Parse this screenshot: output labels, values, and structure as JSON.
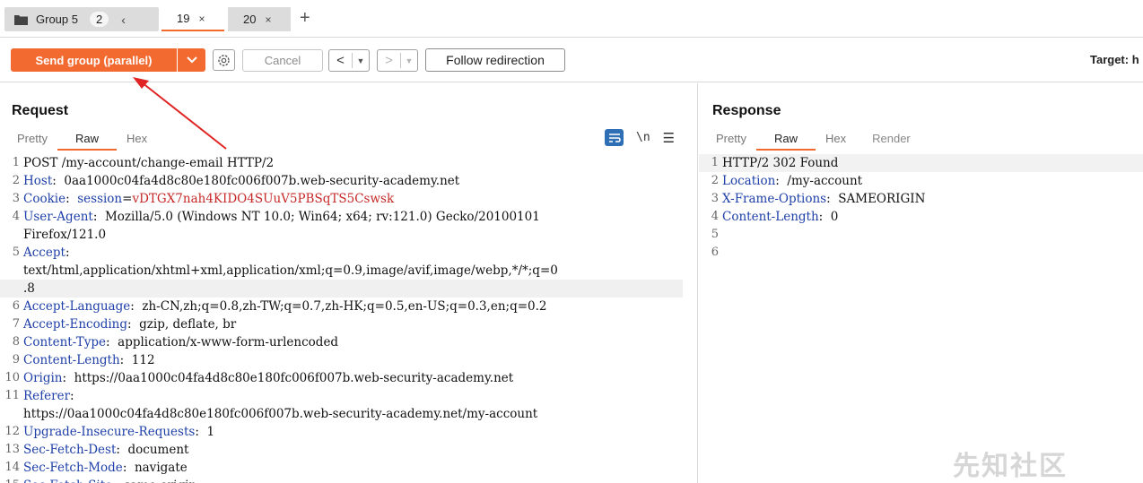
{
  "tabbar": {
    "group_label": "Group 5",
    "group_count": "2",
    "group_collapse": "‹",
    "tabs": [
      {
        "label": "19",
        "close": "×",
        "active": true
      },
      {
        "label": "20",
        "close": "×",
        "active": false
      }
    ],
    "add": "+"
  },
  "toolbar": {
    "send_label": "Send group (parallel)",
    "cancel_label": "Cancel",
    "back_arrow": "<",
    "forward_arrow": ">",
    "follow_label": "Follow redirection",
    "target_label": "Target: h"
  },
  "request": {
    "title": "Request",
    "tabs": [
      "Pretty",
      "Raw",
      "Hex"
    ],
    "active_tab": "Raw",
    "newline_icon": "\\n",
    "lines": [
      {
        "n": "1",
        "parts": [
          {
            "t": "POST /my-account/change-email HTTP/2",
            "c": "plain"
          }
        ]
      },
      {
        "n": "2",
        "parts": [
          {
            "t": "Host",
            "c": "name"
          },
          {
            "t": ":  0aa1000c04fa4d8c80e180fc006f007b.web-security-academy.net",
            "c": "plain"
          }
        ]
      },
      {
        "n": "3",
        "parts": [
          {
            "t": "Cookie",
            "c": "name"
          },
          {
            "t": ":  ",
            "c": "plain"
          },
          {
            "t": "session",
            "c": "name"
          },
          {
            "t": "=",
            "c": "plain"
          },
          {
            "t": "vDTGX7nah4KIDO4SUuV5PBSqTS5Cswsk",
            "c": "cookie"
          }
        ]
      },
      {
        "n": "4",
        "parts": [
          {
            "t": "User-Agent",
            "c": "name"
          },
          {
            "t": ":  Mozilla/5.0 (Windows NT 10.0; Win64; x64; rv:121.0) Gecko/20100101",
            "c": "plain"
          }
        ]
      },
      {
        "n": "",
        "parts": [
          {
            "t": "Firefox/121.0",
            "c": "plain"
          }
        ]
      },
      {
        "n": "5",
        "parts": [
          {
            "t": "Accept",
            "c": "name"
          },
          {
            "t": ":",
            "c": "plain"
          }
        ]
      },
      {
        "n": "",
        "parts": [
          {
            "t": "text/html,application/xhtml+xml,application/xml;q=0.9,image/avif,image/webp,*/*;q=0",
            "c": "plain"
          }
        ]
      },
      {
        "n": "",
        "hl": true,
        "parts": [
          {
            "t": ".8",
            "c": "plain"
          }
        ]
      },
      {
        "n": "6",
        "parts": [
          {
            "t": "Accept-Language",
            "c": "name"
          },
          {
            "t": ":  zh-CN,zh;q=0.8,zh-TW;q=0.7,zh-HK;q=0.5,en-US;q=0.3,en;q=0.2",
            "c": "plain"
          }
        ]
      },
      {
        "n": "7",
        "parts": [
          {
            "t": "Accept-Encoding",
            "c": "name"
          },
          {
            "t": ":  gzip, deflate, br",
            "c": "plain"
          }
        ]
      },
      {
        "n": "8",
        "parts": [
          {
            "t": "Content-Type",
            "c": "name"
          },
          {
            "t": ":  application/x-www-form-urlencoded",
            "c": "plain"
          }
        ]
      },
      {
        "n": "9",
        "parts": [
          {
            "t": "Content-Length",
            "c": "name"
          },
          {
            "t": ":  112",
            "c": "plain"
          }
        ]
      },
      {
        "n": "10",
        "parts": [
          {
            "t": "Origin",
            "c": "name"
          },
          {
            "t": ":  https://0aa1000c04fa4d8c80e180fc006f007b.web-security-academy.net",
            "c": "plain"
          }
        ]
      },
      {
        "n": "11",
        "parts": [
          {
            "t": "Referer",
            "c": "name"
          },
          {
            "t": ":",
            "c": "plain"
          }
        ]
      },
      {
        "n": "",
        "parts": [
          {
            "t": "https://0aa1000c04fa4d8c80e180fc006f007b.web-security-academy.net/my-account",
            "c": "plain"
          }
        ]
      },
      {
        "n": "12",
        "parts": [
          {
            "t": "Upgrade-Insecure-Requests",
            "c": "name"
          },
          {
            "t": ":  1",
            "c": "plain"
          }
        ]
      },
      {
        "n": "13",
        "parts": [
          {
            "t": "Sec-Fetch-Dest",
            "c": "name"
          },
          {
            "t": ":  document",
            "c": "plain"
          }
        ]
      },
      {
        "n": "14",
        "parts": [
          {
            "t": "Sec-Fetch-Mode",
            "c": "name"
          },
          {
            "t": ":  navigate",
            "c": "plain"
          }
        ]
      },
      {
        "n": "15",
        "parts": [
          {
            "t": "Sec-Fetch-Site",
            "c": "name"
          },
          {
            "t": ":  same-origin",
            "c": "plain"
          }
        ]
      }
    ]
  },
  "response": {
    "title": "Response",
    "tabs": [
      "Pretty",
      "Raw",
      "Hex",
      "Render"
    ],
    "active_tab": "Raw",
    "lines": [
      {
        "n": "1",
        "parts": [
          {
            "t": "HTTP/2 302 Found",
            "c": "plain"
          }
        ]
      },
      {
        "n": "2",
        "parts": [
          {
            "t": "Location",
            "c": "name"
          },
          {
            "t": ":  /my-account",
            "c": "plain"
          }
        ]
      },
      {
        "n": "3",
        "parts": [
          {
            "t": "X-Frame-Options",
            "c": "name"
          },
          {
            "t": ":  SAMEORIGIN",
            "c": "plain"
          }
        ]
      },
      {
        "n": "4",
        "parts": [
          {
            "t": "Content-Length",
            "c": "name"
          },
          {
            "t": ":  0",
            "c": "plain"
          }
        ]
      },
      {
        "n": "5",
        "parts": []
      },
      {
        "n": "6",
        "parts": []
      }
    ]
  },
  "watermark": "先知社区",
  "colors": {
    "accent": "#f36a30",
    "header_name": "#1f40a8",
    "cookie_value": "#c62828",
    "annotation_arrow": "#e02424"
  }
}
